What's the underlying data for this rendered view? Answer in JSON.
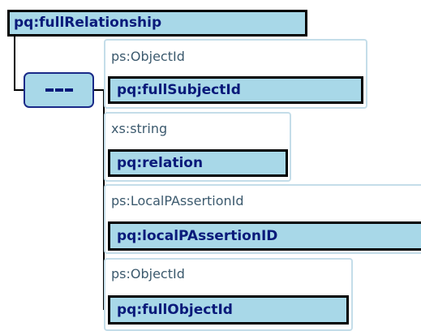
{
  "diagram": {
    "root": {
      "name": "pq:fullRelationship"
    },
    "compositor": {
      "kind": "sequence",
      "icon": "sequence-icon"
    },
    "children": [
      {
        "type": "ps:ObjectId",
        "name": "pq:fullSubjectId"
      },
      {
        "type": "xs:string",
        "name": "pq:relation"
      },
      {
        "type": "ps:LocalPAssertionId",
        "name": "pq:localPAssertionID"
      },
      {
        "type": "ps:ObjectId",
        "name": "pq:fullObjectId"
      }
    ]
  }
}
